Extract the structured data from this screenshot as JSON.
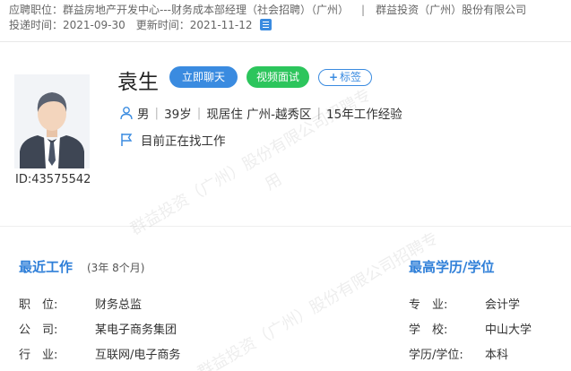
{
  "header": {
    "position_label": "应聘职位：",
    "position_value": "群益房地产开发中心---财务成本部经理（社会招聘）（广州）",
    "separator": "|",
    "company": "群益投资（广州）股份有限公司",
    "apply_time_label": "投递时间：",
    "apply_time": "2021-09-30",
    "update_time_label": "更新时间：",
    "update_time": "2021-11-12",
    "doc_icon": "document-icon"
  },
  "profile": {
    "name": "袁生",
    "chat_button": "立即聊天",
    "video_button": "视频面试",
    "tag_plus": "+",
    "tag_button": "标签",
    "gender": "男",
    "age": "39岁",
    "residence": "现居住 广州-越秀区",
    "experience": "15年工作经验",
    "bar": "|",
    "status": "目前正在找工作",
    "id": "ID:43575542",
    "person_icon": "person-icon",
    "flag_icon": "flag-icon"
  },
  "recent_work": {
    "title": "最近工作",
    "duration": "(3年 8个月)",
    "rows": [
      {
        "label": "职　位:",
        "value": "财务总监"
      },
      {
        "label": "公　司:",
        "value": "某电子商务集团"
      },
      {
        "label": "行　业:",
        "value": "互联网/电子商务"
      }
    ]
  },
  "education": {
    "title": "最高学历/学位",
    "rows": [
      {
        "label": "专　业:",
        "value": "会计学"
      },
      {
        "label": "学　校:",
        "value": "中山大学"
      },
      {
        "label": "学历/学位:",
        "value": "本科"
      }
    ]
  },
  "watermarks": {
    "line1": "群益投资（广州）股份有限公司招聘专",
    "line2": "用"
  }
}
